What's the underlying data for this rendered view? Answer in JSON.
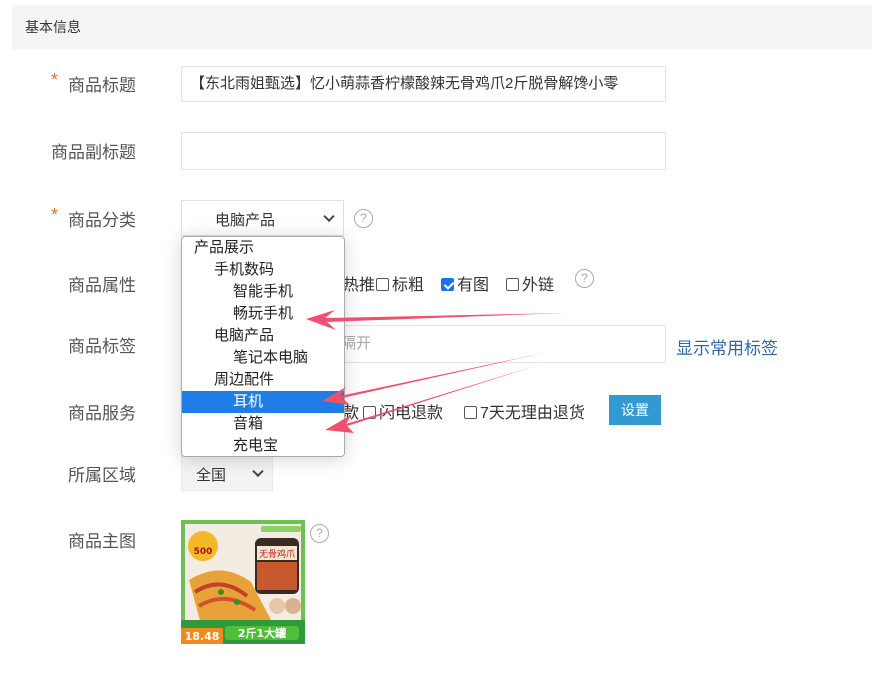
{
  "section": {
    "title": "基本信息"
  },
  "form": {
    "title": {
      "label": "商品标题",
      "value": "【东北雨姐甄选】忆小萌蒜香柠檬酸辣无骨鸡爪2斤脱骨解馋小零"
    },
    "subtitle": {
      "label": "商品副标题",
      "value": ""
    },
    "category": {
      "label": "商品分类",
      "selected": "电脑产品",
      "help": "?"
    },
    "attributes": {
      "label": "商品属性",
      "options": [
        {
          "label": "热推",
          "checked": false
        },
        {
          "label": "标粗",
          "checked": false
        },
        {
          "label": "有图",
          "checked": true
        },
        {
          "label": "外链",
          "checked": false
        }
      ],
      "help": "?"
    },
    "tags": {
      "label": "商品标签",
      "placeholder_tail": "隔开",
      "link": "显示常用标签"
    },
    "services": {
      "label": "商品服务",
      "partial_text": "款",
      "options": [
        {
          "label": "闪电退款",
          "checked": false
        },
        {
          "label": "7天无理由退货",
          "checked": false
        }
      ],
      "button": "设置"
    },
    "region": {
      "label": "所属区域",
      "selected": "全国"
    },
    "main_image": {
      "label": "商品主图",
      "help": "?"
    }
  },
  "dropdown": {
    "items": [
      {
        "label": "产品展示",
        "level": 0,
        "selected": false
      },
      {
        "label": "手机数码",
        "level": 1,
        "selected": false
      },
      {
        "label": "智能手机",
        "level": 2,
        "selected": false
      },
      {
        "label": "畅玩手机",
        "level": 2,
        "selected": false
      },
      {
        "label": "电脑产品",
        "level": 1,
        "selected": false
      },
      {
        "label": "笔记本电脑",
        "level": 2,
        "selected": false
      },
      {
        "label": "周边配件",
        "level": 1,
        "selected": false
      },
      {
        "label": "耳机",
        "level": 2,
        "selected": true
      },
      {
        "label": "音箱",
        "level": 2,
        "selected": false
      },
      {
        "label": "充电宝",
        "level": 2,
        "selected": false
      }
    ]
  },
  "product_image": {
    "badge_number": "500",
    "price": "18.48",
    "banner": "2斤1大罐",
    "jar_label": "无骨鸡爪"
  },
  "colors": {
    "accent": "#3399d0",
    "selected": "#1e7ee6",
    "required": "#e8702a",
    "link": "#2c6aa0",
    "annotation_arrow": "#f0506e"
  }
}
